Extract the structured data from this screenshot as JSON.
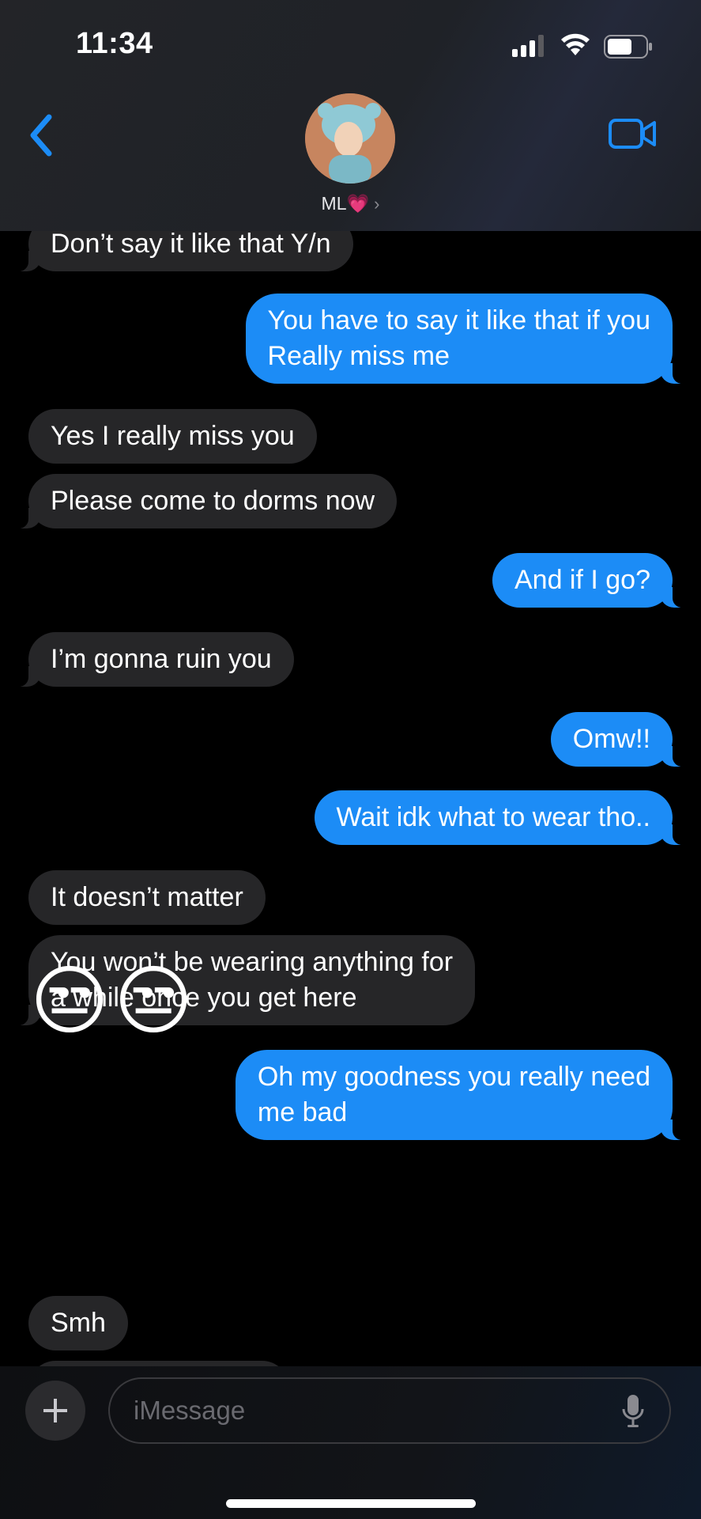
{
  "status_bar": {
    "time": "11:34"
  },
  "header": {
    "contact_name": "ML💗",
    "chevron": "›"
  },
  "messages": [
    {
      "side": "in",
      "text": "Don’t say it like that Y/n"
    },
    {
      "side": "out",
      "text": "You have to say it like that if you\nReally miss me"
    },
    {
      "side": "in",
      "text": "Yes I really miss you"
    },
    {
      "side": "in",
      "text": "Please come to dorms now"
    },
    {
      "side": "out",
      "text": "And if I go?"
    },
    {
      "side": "in",
      "text": "I’m gonna ruin you"
    },
    {
      "side": "out",
      "text": "Omw!!"
    },
    {
      "side": "out",
      "text": "Wait idk what to wear tho.."
    },
    {
      "side": "in",
      "text": "It doesn’t matter"
    },
    {
      "side": "in",
      "text": "You won’t be wearing anything for\na while once you get here"
    },
    {
      "side": "out",
      "text": "Oh my goodness you really need\nme bad"
    },
    {
      "side": "in",
      "type": "emoji",
      "text": "😒😒"
    },
    {
      "side": "in",
      "text": "Smh"
    }
  ],
  "composer": {
    "placeholder": "iMessage"
  },
  "icons": [
    "signal-icon",
    "wifi-icon",
    "battery-icon",
    "back-chevron-icon",
    "video-call-icon",
    "plus-icon",
    "microphone-icon"
  ],
  "colors": {
    "outgoing_bubble": "#1c8cf6",
    "incoming_bubble": "#262628",
    "accent": "#1c8cf6"
  }
}
